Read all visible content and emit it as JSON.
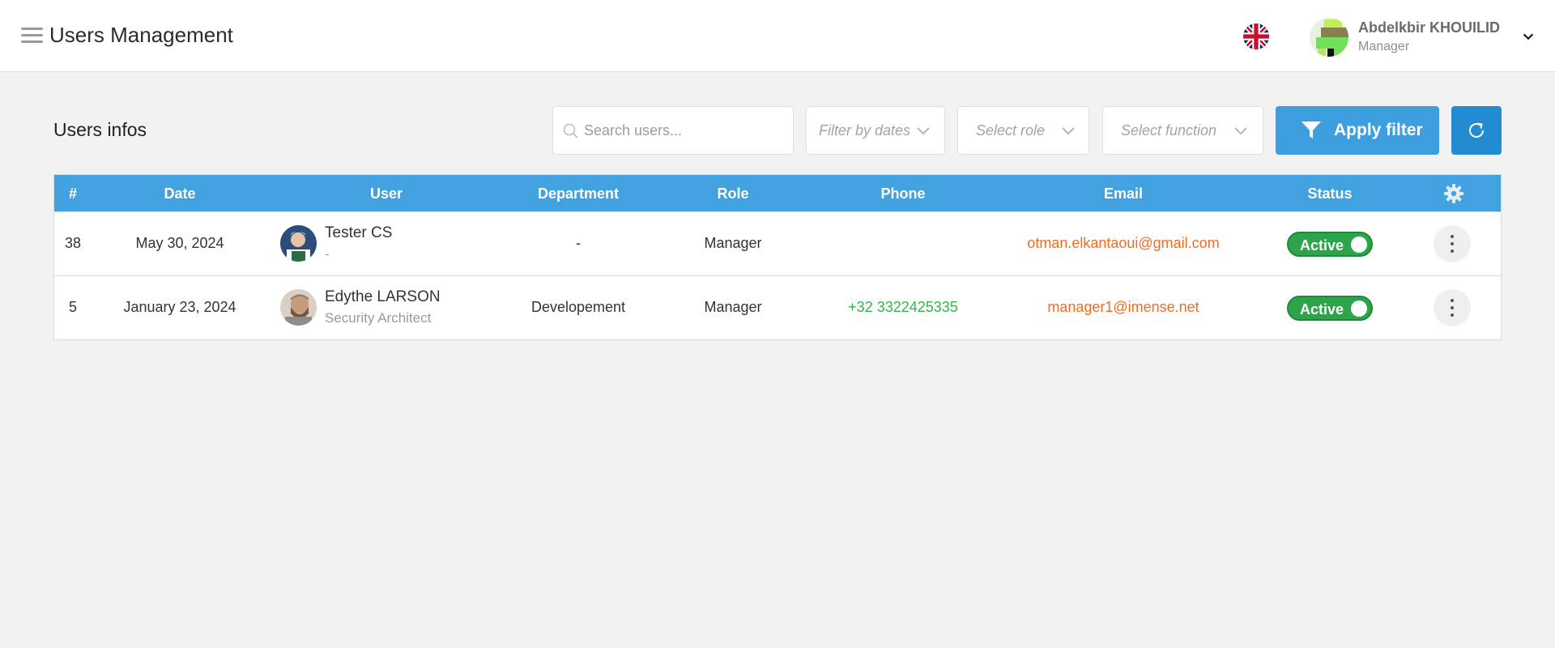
{
  "header": {
    "title": "Users Management",
    "user": {
      "name": "Abdelkbir KHOUILID",
      "role": "Manager"
    }
  },
  "toolbar": {
    "section_title": "Users infos",
    "search_placeholder": "Search users...",
    "filter_dates": "Filter by dates",
    "select_role": "Select role",
    "select_function": "Select function",
    "apply_label": "Apply filter"
  },
  "table": {
    "headers": [
      "#",
      "Date",
      "User",
      "Department",
      "Role",
      "Phone",
      "Email",
      "Status"
    ],
    "rows": [
      {
        "id": "38",
        "date": "May 30, 2024",
        "name": "Tester CS",
        "function": "-",
        "department": "-",
        "role": "Manager",
        "phone": "",
        "email": "otman.elkantaoui@gmail.com",
        "status": "Active"
      },
      {
        "id": "5",
        "date": "January 23, 2024",
        "name": "Edythe LARSON",
        "function": "Security Architect",
        "department": "Developement",
        "role": "Manager",
        "phone": "+32 3322425335",
        "email": "manager1@imense.net",
        "status": "Active"
      }
    ]
  },
  "colors": {
    "header_blue": "#42a2e0",
    "apply_blue": "#3d9fdf",
    "refresh_blue": "#238bd1",
    "status_green": "#2ea44a",
    "phone_green": "#33b34a",
    "email_orange": "#f26b22"
  },
  "icons": {
    "menu": "hamburger-icon",
    "language": "uk-flag-icon",
    "dropdown": "chevron-down-icon",
    "search": "search-icon",
    "filter": "funnel-icon",
    "refresh": "refresh-icon",
    "settings": "gear-icon",
    "row_actions": "kebab-icon"
  }
}
